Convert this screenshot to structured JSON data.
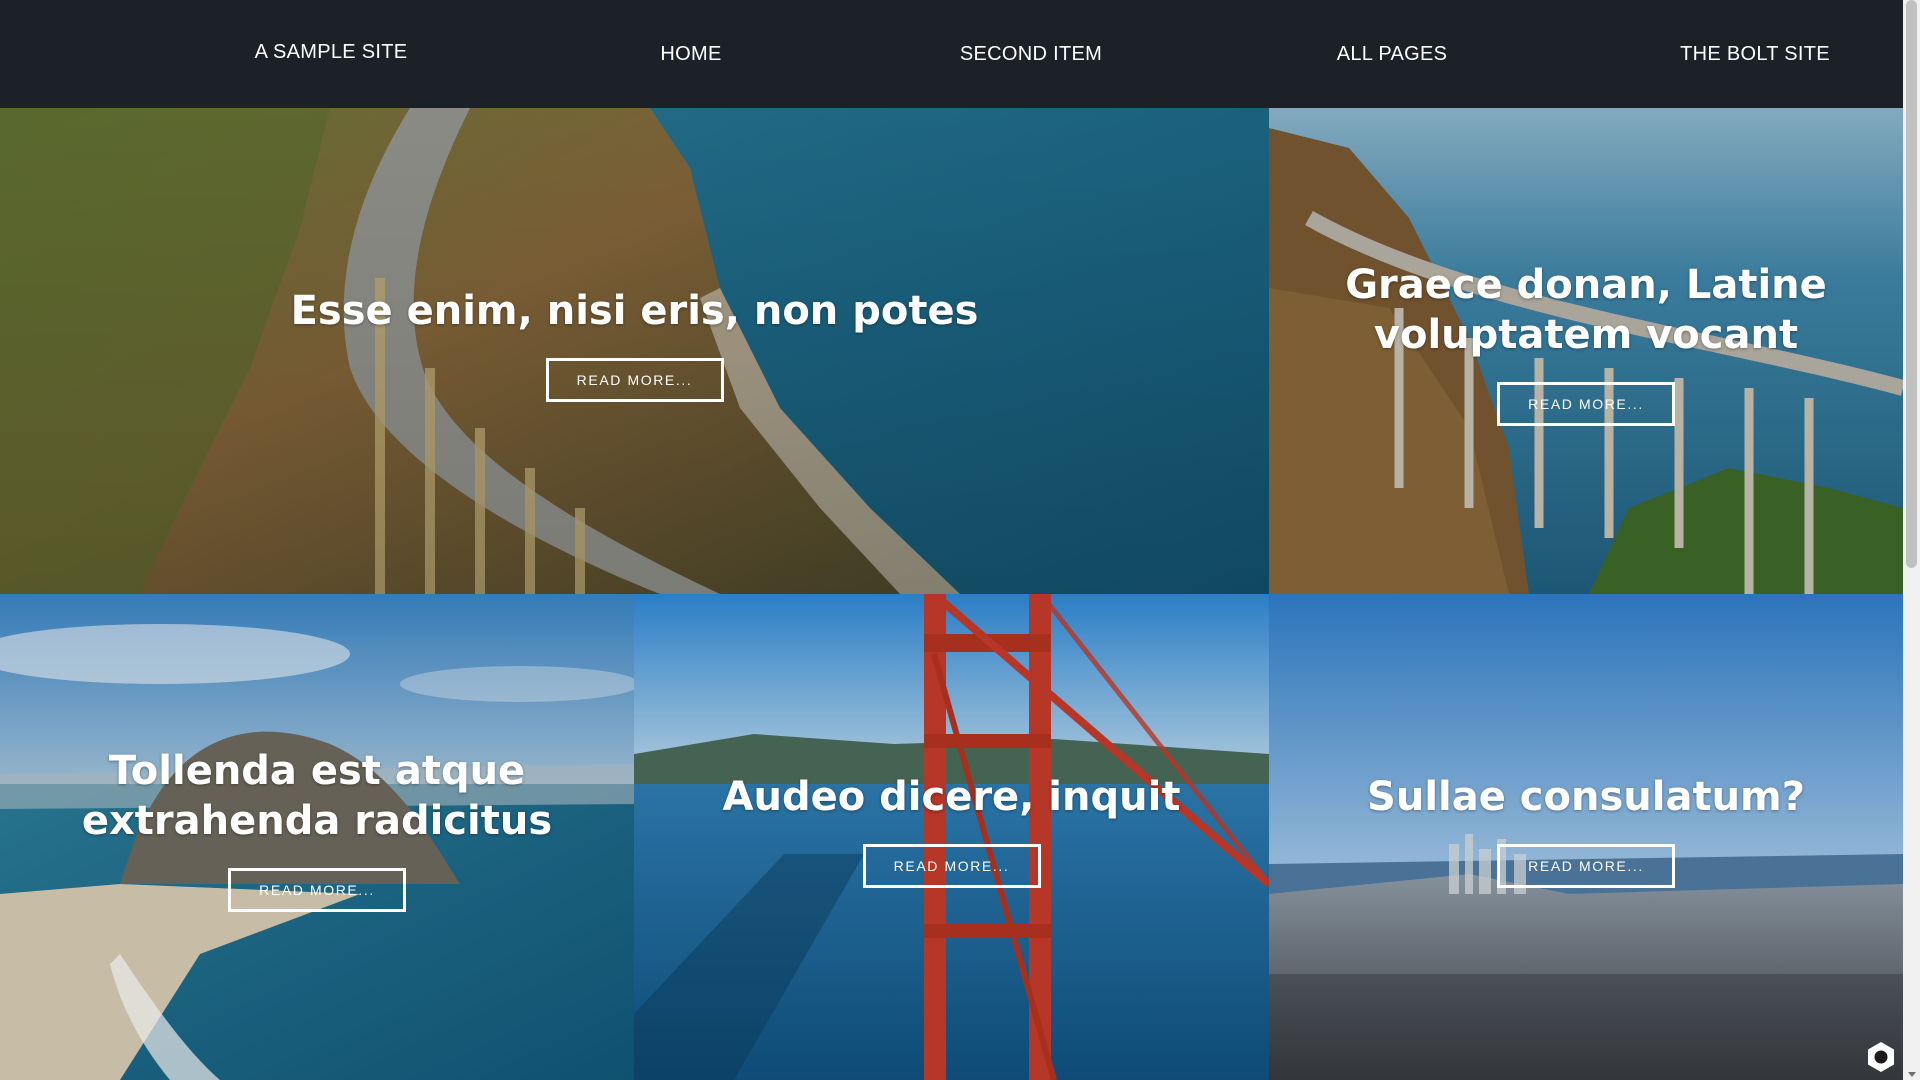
{
  "nav": {
    "brand": "A SAMPLE SITE",
    "items": [
      {
        "label": "HOME"
      },
      {
        "label": "SECOND ITEM"
      },
      {
        "label": "ALL PAGES"
      },
      {
        "label": "THE BOLT SITE"
      }
    ]
  },
  "tiles": [
    {
      "title": "Esse enim, nisi eris, non potes",
      "button": "READ MORE..."
    },
    {
      "title": "Graece donan, Latine voluptatem vocant",
      "button": "READ MORE..."
    },
    {
      "title": "Tollenda est atque extrahenda radicitus",
      "button": "READ MORE..."
    },
    {
      "title": "Audeo dicere, inquit",
      "button": "READ MORE..."
    },
    {
      "title": "Sullae consulatum?",
      "button": "READ MORE..."
    }
  ],
  "colors": {
    "navbar_bg": "#1c2128",
    "text": "#ffffff",
    "ocean": "#1f6f8b",
    "sky": "#2f86cf",
    "bridge_red": "#c0392b"
  },
  "icons": {
    "corner_widget": "hexagon-ring-icon"
  }
}
